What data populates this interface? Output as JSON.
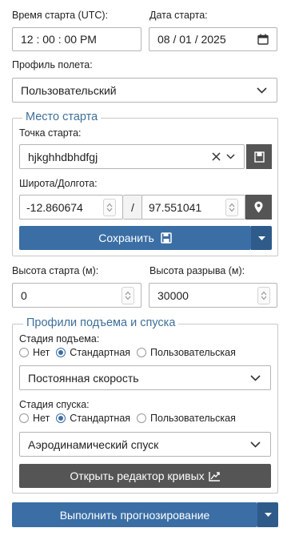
{
  "launch_time": {
    "label": "Время старта (UTC):",
    "value": "12 : 00 : 00   PM"
  },
  "launch_date": {
    "label": "Дата старта:",
    "value": "08 / 01 / 2025"
  },
  "flight_profile": {
    "label": "Профиль полета:",
    "value": "Пользовательский"
  },
  "launch_site": {
    "legend": "Место старта",
    "point_label": "Точка старта:",
    "point_value": "hjkghhdbhdfgj",
    "latlon_label": "Широта/Долгота:",
    "latitude": "-12.860674",
    "separator": "/",
    "longitude": "97.551041",
    "save_label": "Сохранить"
  },
  "launch_altitude": {
    "label": "Высота старта (м):",
    "value": "0"
  },
  "burst_altitude": {
    "label": "Высота разрыва (м):",
    "value": "30000"
  },
  "profiles": {
    "legend": "Профили подъема и спуска",
    "ascent_label": "Стадия подъема:",
    "ascent_options": [
      "Нет",
      "Стандартная",
      "Пользовательская"
    ],
    "ascent_selected": "Стандартная",
    "ascent_dropdown": "Постоянная скорость",
    "descent_label": "Стадия спуска:",
    "descent_options": [
      "Нет",
      "Стандартная",
      "Пользовательская"
    ],
    "descent_selected": "Стандартная",
    "descent_dropdown": "Аэродинамический спуск",
    "curve_editor_label": "Открыть редактор кривых"
  },
  "run_label": "Выполнить прогнозирование",
  "colors": {
    "accent": "#3a6ea5",
    "accent_dark": "#2e5b8a",
    "dark_button": "#555555",
    "legend_text": "#3d6f99"
  }
}
